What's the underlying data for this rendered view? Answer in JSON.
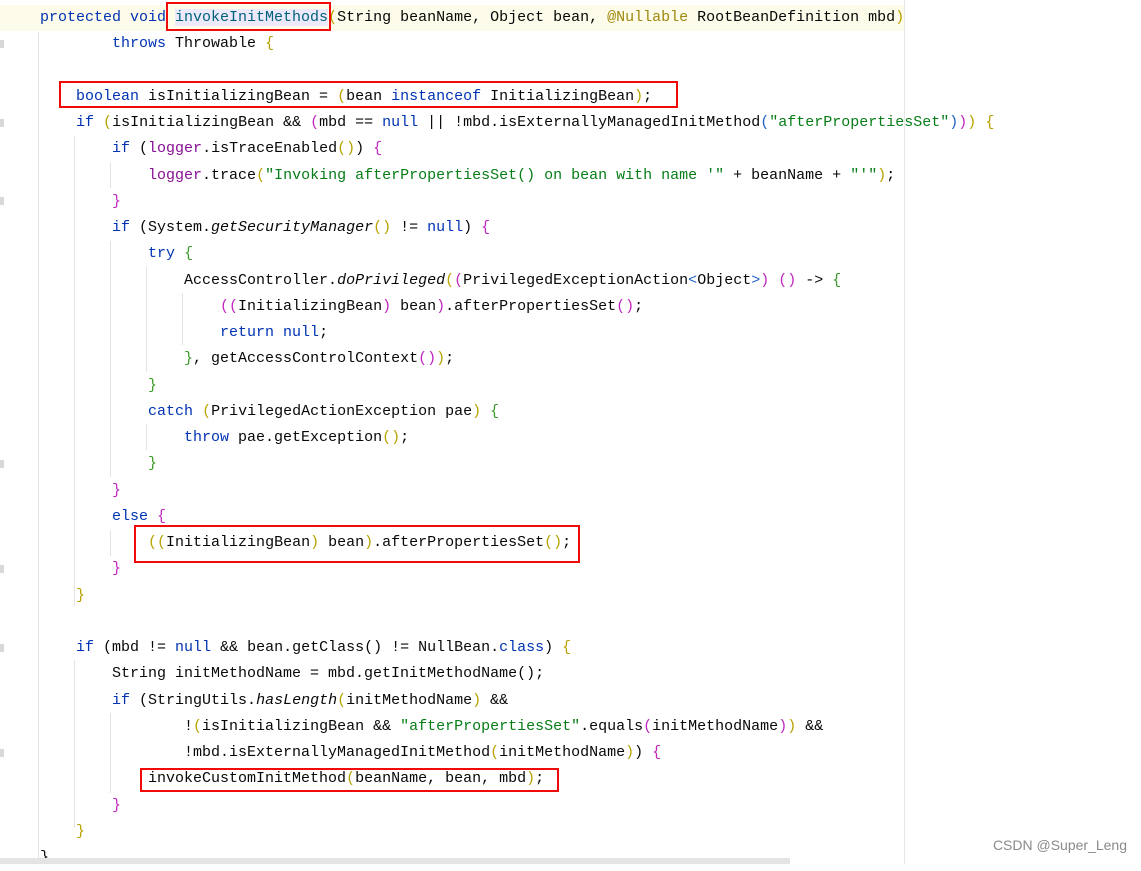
{
  "editor": {
    "language": "java",
    "lines": [
      [
        [
          "k",
          "protected void "
        ],
        [
          "m hl",
          "invokeInitMethods"
        ],
        [
          "y",
          "("
        ],
        [
          "p",
          "String beanName, Object bean, "
        ],
        [
          "a",
          "@Nullable"
        ],
        [
          "p",
          " RootBeanDefinition mbd"
        ],
        [
          "y",
          ")"
        ]
      ],
      [
        [
          "p",
          "        "
        ],
        [
          "k",
          "throws"
        ],
        [
          "p",
          " Throwable "
        ],
        [
          "y",
          "{"
        ]
      ],
      [],
      [
        [
          "p",
          "    "
        ],
        [
          "k",
          "boolean"
        ],
        [
          "p",
          " isInitializingBean = "
        ],
        [
          "y",
          "("
        ],
        [
          "p",
          "bean "
        ],
        [
          "k",
          "instanceof"
        ],
        [
          "p",
          " InitializingBean"
        ],
        [
          "y",
          ")"
        ],
        [
          "p",
          ";"
        ]
      ],
      [
        [
          "p",
          "    "
        ],
        [
          "k",
          "if"
        ],
        [
          "p",
          " "
        ],
        [
          "y",
          "("
        ],
        [
          "p",
          "isInitializingBean && "
        ],
        [
          "v",
          "("
        ],
        [
          "p",
          "mbd == "
        ],
        [
          "k",
          "null"
        ],
        [
          "p",
          " || !mbd.isExternallyManagedInitMethod"
        ],
        [
          "b",
          "("
        ],
        [
          "s",
          "\"afterPropertiesSet\""
        ],
        [
          "b",
          ")"
        ],
        [
          "v",
          ")"
        ],
        [
          "y",
          ")"
        ],
        [
          "p",
          " "
        ],
        [
          "y",
          "{"
        ]
      ],
      [
        [
          "p",
          "        "
        ],
        [
          "k",
          "if"
        ],
        [
          "p",
          " ("
        ],
        [
          "f",
          "logger"
        ],
        [
          "p",
          ".isTraceEnabled"
        ],
        [
          "y",
          "()"
        ],
        [
          "p",
          ") "
        ],
        [
          "v",
          "{"
        ]
      ],
      [
        [
          "p",
          "            "
        ],
        [
          "f",
          "logger"
        ],
        [
          "p",
          ".trace"
        ],
        [
          "y",
          "("
        ],
        [
          "s",
          "\"Invoking afterPropertiesSet() on bean with name '\""
        ],
        [
          "p",
          " + beanName + "
        ],
        [
          "s",
          "\"'\""
        ],
        [
          "y",
          ")"
        ],
        [
          "p",
          ";"
        ]
      ],
      [
        [
          "p",
          "        "
        ],
        [
          "v",
          "}"
        ]
      ],
      [
        [
          "p",
          "        "
        ],
        [
          "k",
          "if"
        ],
        [
          "p",
          " (System."
        ],
        [
          "i",
          "getSecurityManager"
        ],
        [
          "y",
          "()"
        ],
        [
          "p",
          " != "
        ],
        [
          "k",
          "null"
        ],
        [
          "p",
          ") "
        ],
        [
          "v",
          "{"
        ]
      ],
      [
        [
          "p",
          "            "
        ],
        [
          "k",
          "try"
        ],
        [
          "p",
          " "
        ],
        [
          "g",
          "{"
        ]
      ],
      [
        [
          "p",
          "                AccessController."
        ],
        [
          "i",
          "doPrivileged"
        ],
        [
          "y",
          "("
        ],
        [
          "v",
          "("
        ],
        [
          "p",
          "PrivilegedExceptionAction"
        ],
        [
          "b",
          "<"
        ],
        [
          "p",
          "Object"
        ],
        [
          "b",
          ">"
        ],
        [
          "v",
          ")"
        ],
        [
          "p",
          " "
        ],
        [
          "v",
          "()"
        ],
        [
          "p",
          " -> "
        ],
        [
          "g",
          "{"
        ]
      ],
      [
        [
          "p",
          "                    "
        ],
        [
          "v",
          "(("
        ],
        [
          "p",
          "InitializingBean"
        ],
        [
          "v",
          ")"
        ],
        [
          "p",
          " bean"
        ],
        [
          "v",
          ")"
        ],
        [
          "p",
          ".afterPropertiesSet"
        ],
        [
          "v",
          "()"
        ],
        [
          "p",
          ";"
        ]
      ],
      [
        [
          "p",
          "                    "
        ],
        [
          "k",
          "return null"
        ],
        [
          "p",
          ";"
        ]
      ],
      [
        [
          "p",
          "                "
        ],
        [
          "g",
          "}"
        ],
        [
          "p",
          ", getAccessControlContext"
        ],
        [
          "v",
          "()"
        ],
        [
          "y",
          ")"
        ],
        [
          "p",
          ";"
        ]
      ],
      [
        [
          "p",
          "            "
        ],
        [
          "g",
          "}"
        ]
      ],
      [
        [
          "p",
          "            "
        ],
        [
          "k",
          "catch"
        ],
        [
          "p",
          " "
        ],
        [
          "y",
          "("
        ],
        [
          "p",
          "PrivilegedActionException pae"
        ],
        [
          "y",
          ")"
        ],
        [
          "p",
          " "
        ],
        [
          "g",
          "{"
        ]
      ],
      [
        [
          "p",
          "                "
        ],
        [
          "k",
          "throw"
        ],
        [
          "p",
          " pae.getException"
        ],
        [
          "y",
          "()"
        ],
        [
          "p",
          ";"
        ]
      ],
      [
        [
          "p",
          "            "
        ],
        [
          "g",
          "}"
        ]
      ],
      [
        [
          "p",
          "        "
        ],
        [
          "v",
          "}"
        ]
      ],
      [
        [
          "p",
          "        "
        ],
        [
          "k",
          "else"
        ],
        [
          "p",
          " "
        ],
        [
          "v",
          "{"
        ]
      ],
      [
        [
          "p",
          "            "
        ],
        [
          "y",
          "(("
        ],
        [
          "p",
          "InitializingBean"
        ],
        [
          "y",
          ")"
        ],
        [
          "p",
          " bean"
        ],
        [
          "y",
          ")"
        ],
        [
          "p",
          ".afterPropertiesSet"
        ],
        [
          "y",
          "()"
        ],
        [
          "p",
          ";"
        ]
      ],
      [
        [
          "p",
          "        "
        ],
        [
          "v",
          "}"
        ]
      ],
      [
        [
          "p",
          "    "
        ],
        [
          "y",
          "}"
        ]
      ],
      [],
      [
        [
          "p",
          "    "
        ],
        [
          "k",
          "if"
        ],
        [
          "p",
          " (mbd != "
        ],
        [
          "k",
          "null"
        ],
        [
          "p",
          " && bean.getClass() != NullBean."
        ],
        [
          "k",
          "class"
        ],
        [
          "p",
          ") "
        ],
        [
          "y",
          "{"
        ]
      ],
      [
        [
          "p",
          "        String initMethodName = mbd.getInitMethodName();"
        ]
      ],
      [
        [
          "p",
          "        "
        ],
        [
          "k",
          "if"
        ],
        [
          "p",
          " (StringUtils."
        ],
        [
          "i",
          "hasLength"
        ],
        [
          "y",
          "("
        ],
        [
          "p",
          "initMethodName"
        ],
        [
          "y",
          ")"
        ],
        [
          "p",
          " &&"
        ]
      ],
      [
        [
          "p",
          "                !"
        ],
        [
          "y",
          "("
        ],
        [
          "p",
          "isInitializingBean && "
        ],
        [
          "s",
          "\"afterPropertiesSet\""
        ],
        [
          "p",
          ".equals"
        ],
        [
          "v",
          "("
        ],
        [
          "p",
          "initMethodName"
        ],
        [
          "v",
          ")"
        ],
        [
          "y",
          ")"
        ],
        [
          "p",
          " &&"
        ]
      ],
      [
        [
          "p",
          "                !mbd.isExternallyManagedInitMethod"
        ],
        [
          "y",
          "("
        ],
        [
          "p",
          "initMethodName"
        ],
        [
          "y",
          ")"
        ],
        [
          "p",
          ") "
        ],
        [
          "v",
          "{"
        ]
      ],
      [
        [
          "p",
          "            invokeCustomInitMethod"
        ],
        [
          "y",
          "("
        ],
        [
          "p",
          "beanName, bean, mbd"
        ],
        [
          "y",
          ")"
        ],
        [
          "p",
          ";"
        ]
      ],
      [
        [
          "p",
          "        "
        ],
        [
          "v",
          "}"
        ]
      ],
      [
        [
          "p",
          "    "
        ],
        [
          "y",
          "}"
        ]
      ],
      [
        [
          "p",
          "}"
        ]
      ]
    ]
  },
  "highlight_color": "#ff0000",
  "watermark": "CSDN @Super_Leng"
}
